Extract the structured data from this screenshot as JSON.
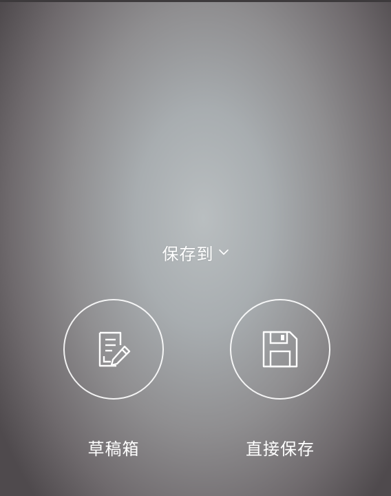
{
  "header": {
    "title": "保存到",
    "dropdown_icon": "chevron-down-icon"
  },
  "options": [
    {
      "label": "草稿箱",
      "icon": "draft-edit-icon"
    },
    {
      "label": "直接保存",
      "icon": "floppy-disk-icon"
    }
  ],
  "colors": {
    "text": "#ffffff",
    "outline": "#ffffff"
  }
}
